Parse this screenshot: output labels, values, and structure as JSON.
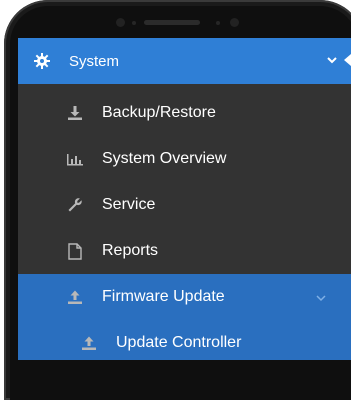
{
  "colors": {
    "header_bg": "#2f7fd6",
    "menu_bg": "#333333",
    "active_bg": "#2a6fbf",
    "text": "#ffffff",
    "icon_muted": "#b8b8b8"
  },
  "sidebar": {
    "header": {
      "label": "System",
      "icon": "gear-icon"
    },
    "items": [
      {
        "label": "Backup/Restore",
        "icon": "download-icon"
      },
      {
        "label": "System Overview",
        "icon": "bar-chart-icon"
      },
      {
        "label": "Service",
        "icon": "wrench-icon"
      },
      {
        "label": "Reports",
        "icon": "document-icon"
      },
      {
        "label": "Firmware Update",
        "icon": "upload-icon"
      },
      {
        "label": "Update Controller",
        "icon": "upload-icon"
      }
    ]
  }
}
